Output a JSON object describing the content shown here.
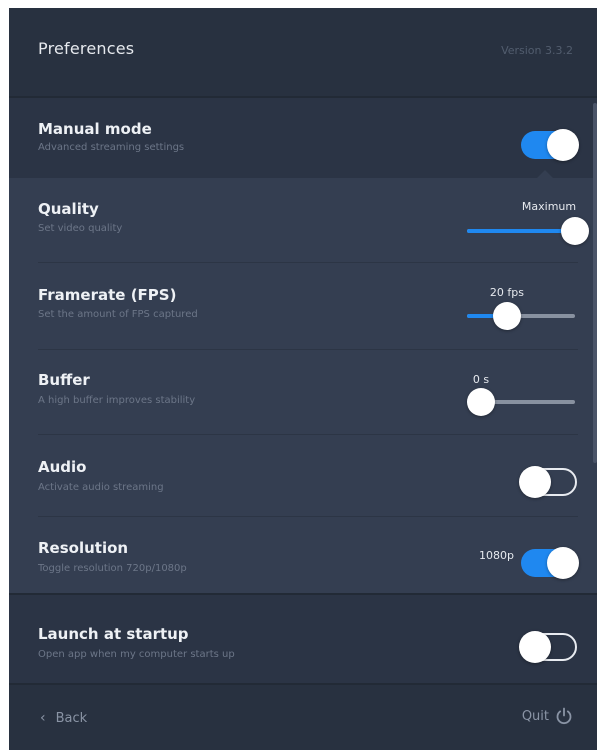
{
  "header": {
    "title": "Preferences",
    "version": "Version 3.3.2"
  },
  "manual_mode": {
    "title": "Manual mode",
    "subtitle": "Advanced streaming settings",
    "enabled": true
  },
  "quality": {
    "title": "Quality",
    "subtitle": "Set video quality",
    "value_label": "Maximum",
    "level": 1.0
  },
  "framerate": {
    "title": "Framerate (FPS)",
    "subtitle": "Set the amount of FPS captured",
    "value_label": "20 fps",
    "level": 0.37
  },
  "buffer": {
    "title": "Buffer",
    "subtitle": "A high buffer improves stability",
    "value_label": "0 s",
    "level": 0.13
  },
  "audio": {
    "title": "Audio",
    "subtitle": "Activate audio streaming",
    "enabled": false
  },
  "resolution": {
    "title": "Resolution",
    "subtitle": "Toggle resolution 720p/1080p",
    "value_label": "1080p",
    "enabled": true
  },
  "launch_at_startup": {
    "title": "Launch at startup",
    "subtitle": "Open app when my computer starts up",
    "enabled": false
  },
  "footer": {
    "back_label": "Back",
    "quit_label": "Quit"
  },
  "colors": {
    "accent": "#1f88f0",
    "panel": "#2a3342",
    "panel_light": "#343e51"
  },
  "icons": {
    "back": "chevron-left-icon",
    "quit": "power-icon"
  }
}
